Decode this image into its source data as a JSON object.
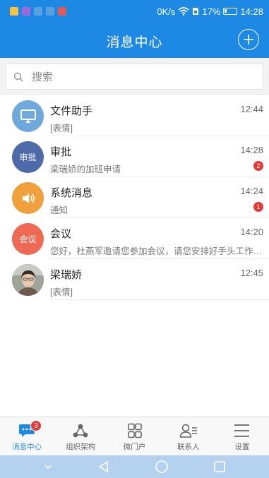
{
  "status_bar": {
    "net_speed": "0K/s",
    "battery_percent": "17%",
    "time": "14:28",
    "notification_colors": [
      "#f5c342",
      "#9c6ade",
      "#5aa0e0",
      "#5aa0e0",
      "#e05a5a"
    ]
  },
  "header": {
    "title": "消息中心",
    "add_icon": "plus-circle-icon"
  },
  "search": {
    "placeholder": "搜索",
    "icon": "search-icon"
  },
  "conversations": [
    {
      "name": "文件助手",
      "time": "12:44",
      "preview": "[表情]",
      "avatar_icon": "monitor-icon",
      "avatar_color": "#6ea8dc",
      "badge": ""
    },
    {
      "name": "审批",
      "time": "14:28",
      "preview": "梁瑞娇的加班申请",
      "avatar_text": "审批",
      "avatar_color": "#4e6aa8",
      "badge": "2"
    },
    {
      "name": "系统消息",
      "time": "14:24",
      "preview": "通知",
      "avatar_icon": "speaker-icon",
      "avatar_color": "#f0a03c",
      "badge": "1"
    },
    {
      "name": "会议",
      "time": "14:20",
      "preview": "您好，杜燕军邀请您参加会议，请您安排好手头工作，...",
      "avatar_text": "会议",
      "avatar_color": "#ee6a55",
      "badge": ""
    },
    {
      "name": "梁瑞娇",
      "time": "12:45",
      "preview": "[表情]",
      "avatar_icon": "user-photo",
      "avatar_color": "#8c8c8c",
      "badge": ""
    }
  ],
  "tabs": [
    {
      "label": "消息中心",
      "icon": "chat-icon",
      "active": true,
      "badge": "3"
    },
    {
      "label": "组织架构",
      "icon": "org-chart-icon",
      "active": false
    },
    {
      "label": "微门户",
      "icon": "grid-icon",
      "active": false
    },
    {
      "label": "联系人",
      "icon": "contact-icon",
      "active": false
    },
    {
      "label": "设置",
      "icon": "menu-lines-icon",
      "active": false
    }
  ],
  "colors": {
    "primary": "#1e88e5",
    "badge": "#e53935",
    "nav_bar": "#b4d1f0"
  }
}
